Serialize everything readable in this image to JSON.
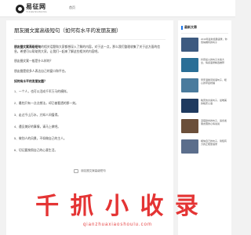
{
  "site": {
    "name": "易征网",
    "subtitle": "YIZHENGWANG"
  },
  "nav": {
    "home": "首页"
  },
  "article": {
    "title": "朋友圈文案高级短句（如何有水平的发朋友圈）",
    "intro_bold": "朋友圈文案高级短句",
    "intro_rest": "的相关话题和大家都想深入了解的内容。对于这一点，那么我们整理收集了关于这方面的信息。希望可以帮助到大家，让我们一起来了解这些相关的内容吧。",
    "para1": "朋友圈文案一般是什么样的？",
    "para2": "朋友圈是很多人表达自己的窗口和平台。",
    "heading": "如何有水平的发朋友圈？",
    "items": [
      "1、一个人，也可以活成千军万马的模样。",
      "2、最怕只有一点点想法，却已被看透的那一刻。",
      "3、走过千山万水，方知人间值得。",
      "4、遇见美好的事情，请马上做吧。",
      "5、做别人的风景，不如做自己的主人。",
      "6、切记要按照自己的心意生活。"
    ],
    "figure_caption": "朋友圈文案高级短句"
  },
  "sidebar": {
    "heading": "最新文章",
    "items": [
      {
        "text": "2019年最新经典语录，你值得拥有的句子"
      },
      {
        "text": "抖音最火的句子文案大全，情感语录精选推荐"
      },
      {
        "text": "早安温馨问候语句子，暖心的早晨祝福"
      },
      {
        "text": "晚安的文案句子，最唯美的晚安心语"
      },
      {
        "text": "深夜励志的句子，适合发朋友圈的心情说说"
      },
      {
        "text": "相信自己的句子，简短有力的正能量语录"
      }
    ],
    "thumb_colors": [
      "#3d5a80",
      "#2a6f97",
      "#4a7b9d",
      "#1f3a5f",
      "#6b4f3a",
      "#5b6e8c"
    ]
  },
  "watermark": {
    "text": "千 抓 小 收 录",
    "url": "qianzhuaxiaoshoulu.com"
  }
}
